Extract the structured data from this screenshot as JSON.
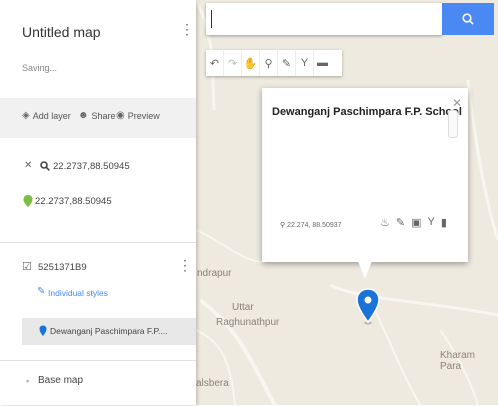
{
  "map": {
    "places": [
      "ndrapur",
      "Uttar",
      "Raghunathpur",
      "Kharam Para",
      "alsbera"
    ]
  },
  "search": {
    "value": "",
    "placeholder": ""
  },
  "tools": [
    {
      "icon": "undo-icon"
    },
    {
      "icon": "redo-icon"
    },
    {
      "icon": "hand-icon"
    },
    {
      "icon": "add-marker-icon"
    },
    {
      "icon": "draw-line-icon"
    },
    {
      "icon": "route-icon"
    },
    {
      "icon": "ruler-icon"
    }
  ],
  "panel": {
    "title": "Untitled map",
    "status": "Saving...",
    "add_layer": "Add layer",
    "share": "Share",
    "preview": "Preview",
    "search_result_query": "22.2737,88.50945",
    "search_result_coords": "22.2737,88.50945",
    "layer_name": "5251371B9",
    "layer_style": "Individual styles",
    "layer_item": "Dewanganj Paschimpara F.P....",
    "base_map": "Base map"
  },
  "info_window": {
    "title": "Dewanganj Paschimpara F.P. School",
    "coords": "22.274, 88.50937"
  },
  "colors": {
    "accent": "#4a89f3",
    "marker": "#1a73d9",
    "search_marker": "#7cc043",
    "map_bg": "#efeae0"
  }
}
